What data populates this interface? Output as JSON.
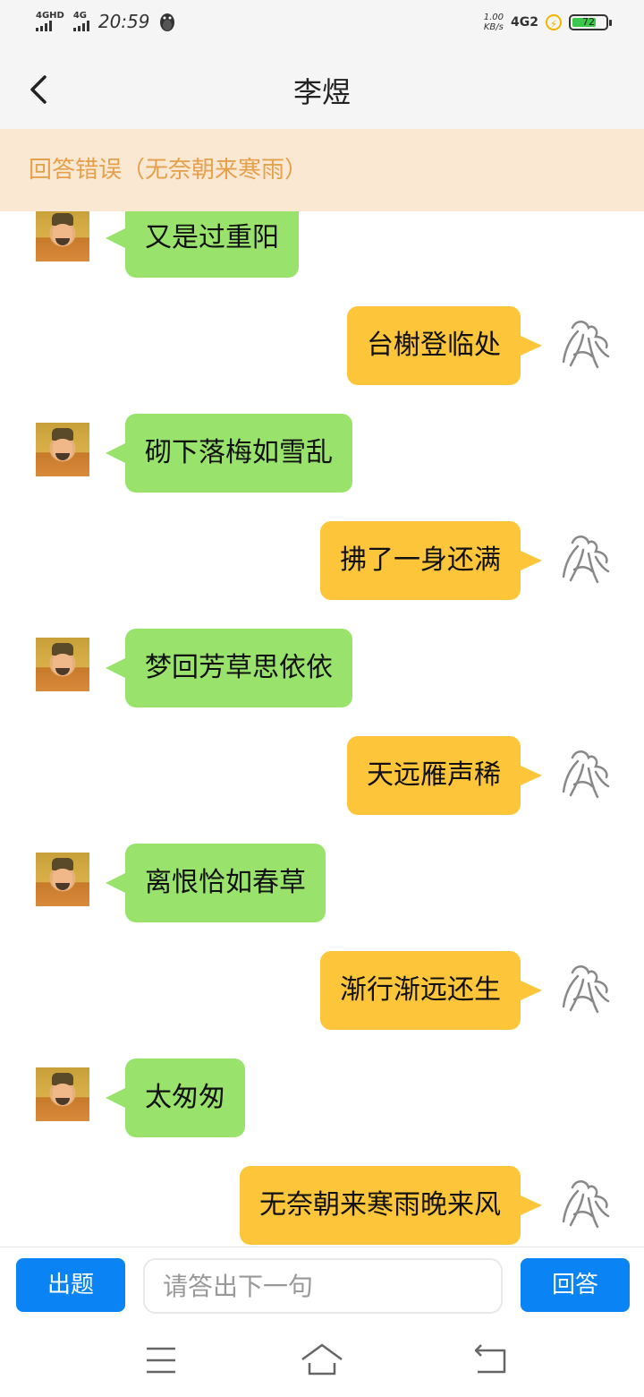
{
  "status_bar": {
    "network1": "4GHD",
    "network2": "4G",
    "time": "20:59",
    "speed_value": "1.00",
    "speed_unit": "KB/s",
    "network_right": "4G2",
    "battery": "72",
    "battery_level": 0.72,
    "icons": [
      "qq-penguin-icon",
      "signal-icon",
      "charging-icon",
      "battery-icon"
    ]
  },
  "header": {
    "title": "李煜",
    "back_icon": "back-chevron-icon"
  },
  "notice": {
    "text": "回答错误（无奈朝来寒雨）"
  },
  "messages": [
    {
      "side": "left",
      "text": "又是过重阳"
    },
    {
      "side": "right",
      "text": "台榭登临处"
    },
    {
      "side": "left",
      "text": "砌下落梅如雪乱"
    },
    {
      "side": "right",
      "text": "拂了一身还满"
    },
    {
      "side": "left",
      "text": "梦回芳草思依依"
    },
    {
      "side": "right",
      "text": "天远雁声稀"
    },
    {
      "side": "left",
      "text": "离恨恰如春草"
    },
    {
      "side": "right",
      "text": "渐行渐远还生"
    },
    {
      "side": "left",
      "text": "太匆匆"
    },
    {
      "side": "right",
      "text": "无奈朝来寒雨晚来风"
    }
  ],
  "input_bar": {
    "left_button": "出题",
    "placeholder": "请答出下一句",
    "value": "",
    "right_button": "回答"
  },
  "nav_bar": {
    "icons": [
      "menu-icon",
      "home-icon",
      "back-icon"
    ]
  },
  "colors": {
    "left_bubble": "#99e36d",
    "right_bubble": "#fdc63a",
    "notice_bg": "#fbe8d3",
    "notice_text": "#e5a04b",
    "button": "#0a84f5"
  }
}
